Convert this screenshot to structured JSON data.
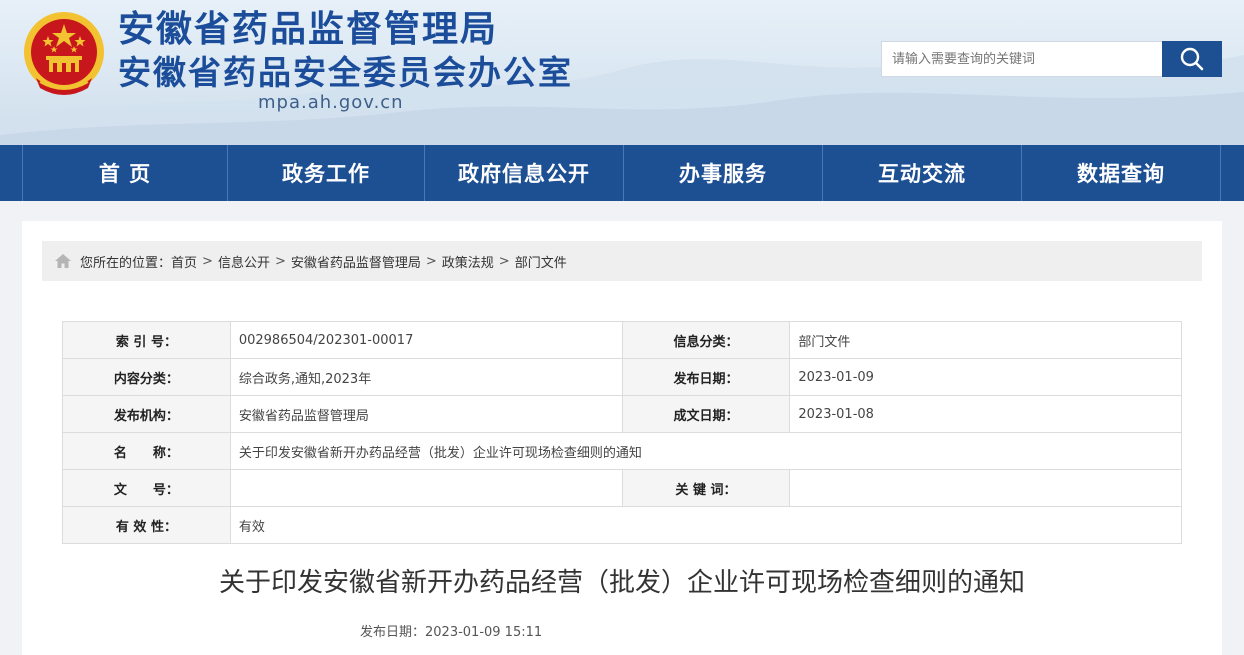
{
  "header": {
    "title": "安徽省药品监督管理局",
    "subtitle": "安徽省药品安全委员会办公室",
    "domain": "mpa.ah.gov.cn",
    "emblem_icon": "national-emblem-icon",
    "search": {
      "placeholder": "请输入需要查询的关键词",
      "icon": "search-icon"
    }
  },
  "nav": {
    "items": [
      {
        "label": "首 页"
      },
      {
        "label": "政务工作"
      },
      {
        "label": "政府信息公开"
      },
      {
        "label": "办事服务"
      },
      {
        "label": "互动交流"
      },
      {
        "label": "数据查询"
      }
    ]
  },
  "breadcrumb": {
    "prefix": "您所在的位置：",
    "items": [
      "首页",
      "信息公开",
      "安徽省药品监督管理局",
      "政策法规",
      "部门文件"
    ],
    "separator": ">",
    "icon": "home-icon"
  },
  "meta": {
    "index_label": "索 引 号：",
    "index_value": "002986504/202301-00017",
    "category_label": "信息分类：",
    "category_value": "部门文件",
    "content_type_label": "内容分类：",
    "content_type_value": "综合政务,通知,2023年",
    "publish_date_label": "发布日期：",
    "publish_date_value": "2023-01-09",
    "issuer_label": "发布机构：",
    "issuer_value": "安徽省药品监督管理局",
    "created_date_label": "成文日期：",
    "created_date_value": "2023-01-08",
    "name_label": "名　　称：",
    "name_value": "关于印发安徽省新开办药品经营（批发）企业许可现场检查细则的通知",
    "doc_no_label": "文　　号：",
    "doc_no_value": "",
    "keywords_label": "关 键 词：",
    "keywords_value": "",
    "validity_label": "有 效 性：",
    "validity_value": "有效"
  },
  "article": {
    "title": "关于印发安徽省新开办药品经营（批发）企业许可现场检查细则的通知",
    "date": "发布日期：2023-01-09 15:11"
  },
  "colors": {
    "brand_blue": "#1d4f93",
    "title_blue": "#1b4d9a",
    "emblem_red": "#c8161d",
    "emblem_gold": "#f2c230"
  }
}
